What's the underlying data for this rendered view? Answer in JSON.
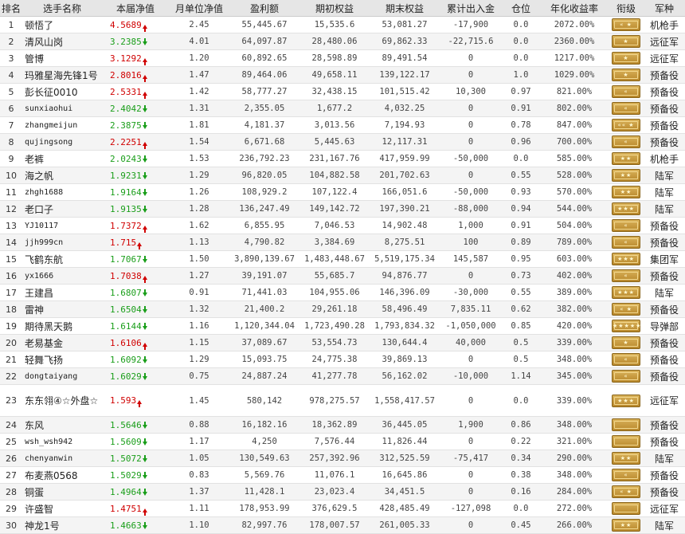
{
  "headers": [
    "排名",
    "选手名称",
    "本届净值",
    "月单位净值",
    "盈利额",
    "期初权益",
    "期末权益",
    "累计出入金",
    "仓位",
    "年化收益率",
    "衔级",
    "军种"
  ],
  "rows": [
    {
      "rank": "1",
      "name": "顿悟了",
      "nav": "4.5689",
      "dir": "up",
      "monthly": "2.45",
      "profit": "55,445.67",
      "initial": "15,535.6",
      "final": "53,081.27",
      "flow": "-17,900",
      "position": "0.0",
      "annual": "2072.00%",
      "rank_badge": "chevron-star",
      "army": "机枪手"
    },
    {
      "rank": "2",
      "name": "清风山岗",
      "nav": "3.2385",
      "dir": "down",
      "monthly": "4.01",
      "profit": "64,097.87",
      "initial": "28,480.06",
      "final": "69,862.33",
      "flow": "-22,715.6",
      "position": "0.0",
      "annual": "2360.00%",
      "rank_badge": "star",
      "army": "远征军"
    },
    {
      "rank": "3",
      "name": "管博",
      "nav": "3.1292",
      "dir": "up",
      "monthly": "1.20",
      "profit": "60,892.65",
      "initial": "28,598.89",
      "final": "89,491.54",
      "flow": "0",
      "position": "0.0",
      "annual": "1217.00%",
      "rank_badge": "star",
      "army": "远征军"
    },
    {
      "rank": "4",
      "name": "玛雅星海先锋1号",
      "nav": "2.8016",
      "dir": "up",
      "monthly": "1.47",
      "profit": "89,464.06",
      "initial": "49,658.11",
      "final": "139,122.17",
      "flow": "0",
      "position": "1.0",
      "annual": "1029.00%",
      "rank_badge": "star",
      "army": "预备役"
    },
    {
      "rank": "5",
      "name": "彭长征0010",
      "nav": "2.5331",
      "dir": "up",
      "monthly": "1.42",
      "profit": "58,777.27",
      "initial": "32,438.15",
      "final": "101,515.42",
      "flow": "10,300",
      "position": "0.97",
      "annual": "821.00%",
      "rank_badge": "chevron",
      "army": "预备役"
    },
    {
      "rank": "6",
      "name": "sunxiaohui",
      "nav": "2.4042",
      "dir": "down",
      "monthly": "1.31",
      "profit": "2,355.05",
      "initial": "1,677.2",
      "final": "4,032.25",
      "flow": "0",
      "position": "0.91",
      "annual": "802.00%",
      "rank_badge": "chevron",
      "army": "预备役",
      "mono": true
    },
    {
      "rank": "7",
      "name": "zhangmeijun",
      "nav": "2.3875",
      "dir": "down",
      "monthly": "1.81",
      "profit": "4,181.37",
      "initial": "3,013.56",
      "final": "7,194.93",
      "flow": "0",
      "position": "0.78",
      "annual": "847.00%",
      "rank_badge": "chevron3",
      "army": "预备役",
      "mono": true
    },
    {
      "rank": "8",
      "name": "qujingsong",
      "nav": "2.2251",
      "dir": "up",
      "monthly": "1.54",
      "profit": "6,671.68",
      "initial": "5,445.63",
      "final": "12,117.31",
      "flow": "0",
      "position": "0.96",
      "annual": "700.00%",
      "rank_badge": "chevron",
      "army": "预备役",
      "mono": true
    },
    {
      "rank": "9",
      "name": "老裤",
      "nav": "2.0243",
      "dir": "down",
      "monthly": "1.53",
      "profit": "236,792.23",
      "initial": "231,167.76",
      "final": "417,959.99",
      "flow": "-50,000",
      "position": "0.0",
      "annual": "585.00%",
      "rank_badge": "2star",
      "army": "机枪手"
    },
    {
      "rank": "10",
      "name": "海之帆",
      "nav": "1.9231",
      "dir": "down",
      "monthly": "1.29",
      "profit": "96,820.05",
      "initial": "104,882.58",
      "final": "201,702.63",
      "flow": "0",
      "position": "0.55",
      "annual": "528.00%",
      "rank_badge": "2star",
      "army": "陆军"
    },
    {
      "rank": "11",
      "name": "zhgh1688",
      "nav": "1.9164",
      "dir": "down",
      "monthly": "1.26",
      "profit": "108,929.2",
      "initial": "107,122.4",
      "final": "166,051.6",
      "flow": "-50,000",
      "position": "0.93",
      "annual": "570.00%",
      "rank_badge": "2star",
      "army": "陆军",
      "mono": true
    },
    {
      "rank": "12",
      "name": "老口子",
      "nav": "1.9135",
      "dir": "down",
      "monthly": "1.28",
      "profit": "136,247.49",
      "initial": "149,142.72",
      "final": "197,390.21",
      "flow": "-88,000",
      "position": "0.94",
      "annual": "544.00%",
      "rank_badge": "3star",
      "army": "陆军"
    },
    {
      "rank": "13",
      "name": "YJ10117",
      "nav": "1.7372",
      "dir": "up",
      "monthly": "1.62",
      "profit": "6,855.95",
      "initial": "7,046.53",
      "final": "14,902.48",
      "flow": "1,000",
      "position": "0.91",
      "annual": "504.00%",
      "rank_badge": "chevron",
      "army": "预备役",
      "mono": true
    },
    {
      "rank": "14",
      "name": "jjh999cn",
      "nav": "1.715",
      "dir": "up",
      "monthly": "1.13",
      "profit": "4,790.82",
      "initial": "3,384.69",
      "final": "8,275.51",
      "flow": "100",
      "position": "0.89",
      "annual": "789.00%",
      "rank_badge": "chevron",
      "army": "预备役",
      "mono": true
    },
    {
      "rank": "15",
      "name": "飞鹤东航",
      "nav": "1.7067",
      "dir": "down",
      "monthly": "1.50",
      "profit": "3,890,139.67",
      "initial": "1,483,448.67",
      "final": "5,519,175.34",
      "flow": "145,587",
      "position": "0.95",
      "annual": "603.00%",
      "rank_badge": "3star",
      "army": "集团军"
    },
    {
      "rank": "16",
      "name": "yx1666",
      "nav": "1.7038",
      "dir": "up",
      "monthly": "1.27",
      "profit": "39,191.07",
      "initial": "55,685.7",
      "final": "94,876.77",
      "flow": "0",
      "position": "0.73",
      "annual": "402.00%",
      "rank_badge": "chevron",
      "army": "预备役",
      "mono": true
    },
    {
      "rank": "17",
      "name": "王建昌",
      "nav": "1.6807",
      "dir": "down",
      "monthly": "0.91",
      "profit": "71,441.03",
      "initial": "104,955.06",
      "final": "146,396.09",
      "flow": "-30,000",
      "position": "0.55",
      "annual": "389.00%",
      "rank_badge": "3star",
      "army": "陆军"
    },
    {
      "rank": "18",
      "name": "雷神",
      "nav": "1.6504",
      "dir": "down",
      "monthly": "1.32",
      "profit": "21,400.2",
      "initial": "29,261.18",
      "final": "58,496.49",
      "flow": "7,835.11",
      "position": "0.62",
      "annual": "382.00%",
      "rank_badge": "chevron-star",
      "army": "预备役"
    },
    {
      "rank": "19",
      "name": "期待黑天鹅",
      "nav": "1.6144",
      "dir": "down",
      "monthly": "1.16",
      "profit": "1,120,344.04",
      "initial": "1,723,490.28",
      "final": "1,793,834.32",
      "flow": "-1,050,000",
      "position": "0.85",
      "annual": "420.00%",
      "rank_badge": "5star",
      "army": "导弹部"
    },
    {
      "rank": "20",
      "name": "老易基金",
      "nav": "1.6106",
      "dir": "up",
      "monthly": "1.15",
      "profit": "37,089.67",
      "initial": "53,554.73",
      "final": "130,644.4",
      "flow": "40,000",
      "position": "0.5",
      "annual": "339.00%",
      "rank_badge": "star",
      "army": "预备役"
    },
    {
      "rank": "21",
      "name": "轻舞飞扬",
      "nav": "1.6092",
      "dir": "down",
      "monthly": "1.29",
      "profit": "15,093.75",
      "initial": "24,775.38",
      "final": "39,869.13",
      "flow": "0",
      "position": "0.5",
      "annual": "348.00%",
      "rank_badge": "chevron",
      "army": "预备役"
    },
    {
      "rank": "22",
      "name": "dongtaiyang",
      "nav": "1.6029",
      "dir": "down",
      "monthly": "0.75",
      "profit": "24,887.24",
      "initial": "41,277.78",
      "final": "56,162.02",
      "flow": "-10,000",
      "position": "1.14",
      "annual": "345.00%",
      "rank_badge": "chevron",
      "army": "预备役",
      "mono": true
    },
    {
      "rank": "23",
      "name": "东东翎④☆外盘☆",
      "nav": "1.593",
      "dir": "up",
      "monthly": "1.45",
      "profit": "580,142",
      "initial": "978,275.57",
      "final": "1,558,417.57",
      "flow": "0",
      "position": "0.0",
      "annual": "339.00%",
      "rank_badge": "3star",
      "army": "远征军",
      "wrap": true
    },
    {
      "rank": "24",
      "name": "东风",
      "nav": "1.5646",
      "dir": "down",
      "monthly": "0.88",
      "profit": "16,182.16",
      "initial": "18,362.89",
      "final": "36,445.05",
      "flow": "1,900",
      "position": "0.86",
      "annual": "348.00%",
      "rank_badge": "blank",
      "army": "预备役"
    },
    {
      "rank": "25",
      "name": "wsh_wsh942",
      "nav": "1.5609",
      "dir": "down",
      "monthly": "1.17",
      "profit": "4,250",
      "initial": "7,576.44",
      "final": "11,826.44",
      "flow": "0",
      "position": "0.22",
      "annual": "321.00%",
      "rank_badge": "blank",
      "army": "预备役",
      "mono": true
    },
    {
      "rank": "26",
      "name": "chenyanwin",
      "nav": "1.5072",
      "dir": "down",
      "monthly": "1.05",
      "profit": "130,549.63",
      "initial": "257,392.96",
      "final": "312,525.59",
      "flow": "-75,417",
      "position": "0.34",
      "annual": "290.00%",
      "rank_badge": "2star",
      "army": "陆军",
      "mono": true
    },
    {
      "rank": "27",
      "name": "布麦燕0568",
      "nav": "1.5029",
      "dir": "down",
      "monthly": "0.83",
      "profit": "5,569.76",
      "initial": "11,076.1",
      "final": "16,645.86",
      "flow": "0",
      "position": "0.38",
      "annual": "348.00%",
      "rank_badge": "chevron",
      "army": "预备役"
    },
    {
      "rank": "28",
      "name": "铜蛋",
      "nav": "1.4964",
      "dir": "down",
      "monthly": "1.37",
      "profit": "11,428.1",
      "initial": "23,023.4",
      "final": "34,451.5",
      "flow": "0",
      "position": "0.16",
      "annual": "284.00%",
      "rank_badge": "chevron-star",
      "army": "预备役"
    },
    {
      "rank": "29",
      "name": "许盛智",
      "nav": "1.4751",
      "dir": "up",
      "monthly": "1.11",
      "profit": "178,953.99",
      "initial": "376,629.5",
      "final": "428,485.49",
      "flow": "-127,098",
      "position": "0.0",
      "annual": "272.00%",
      "rank_badge": "blank",
      "army": "远征军"
    },
    {
      "rank": "30",
      "name": "神龙1号",
      "nav": "1.4663",
      "dir": "down",
      "monthly": "1.10",
      "profit": "82,997.76",
      "initial": "178,007.57",
      "final": "261,005.33",
      "flow": "0",
      "position": "0.45",
      "annual": "266.00%",
      "rank_badge": "2star",
      "army": "陆军"
    }
  ],
  "badge_symbols": {
    "star": "★",
    "2star": "★★",
    "3star": "★★★",
    "5star": "★★★★★",
    "chevron": "«",
    "chevron3": "«« ★",
    "chevron-star": "« ★",
    "blank": ""
  },
  "colors": {
    "up": "#d00000",
    "down": "#1a9e1a",
    "header_bg": "#e6e6e6",
    "badge_gold": "#c99a3a"
  }
}
